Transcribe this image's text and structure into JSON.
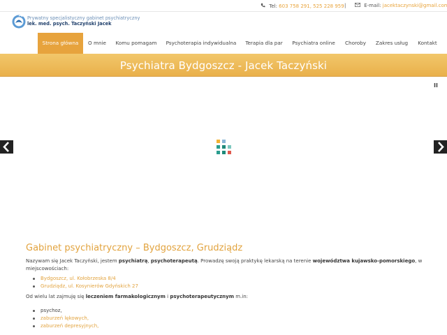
{
  "topbar": {
    "tel_label": "Tel:",
    "tel_numbers": "603 758 291, 525 228 959",
    "separator": "|",
    "email_label": "E-mail:",
    "email": "jacektaczynski@gmail.com"
  },
  "logo": {
    "line1": "Prywatny specjalistyczny gabinet psychiatryczny",
    "line2": "lek. med. psych. Taczyński Jacek"
  },
  "nav": {
    "items": [
      {
        "label": "Strona główna",
        "active": true
      },
      {
        "label": "O mnie"
      },
      {
        "label": "Komu pomagam"
      },
      {
        "label": "Psychoterapia indywidualna"
      },
      {
        "label": "Terapia dla par"
      },
      {
        "label": "Psychiatra online"
      },
      {
        "label": "Choroby"
      },
      {
        "label": "Zakres usług"
      },
      {
        "label": "Kontakt"
      }
    ]
  },
  "banner": {
    "title": "Psychiatra Bydgoszcz - Jacek Taczyński"
  },
  "slider": {
    "pause_glyph": "II"
  },
  "content": {
    "heading": "Gabinet psychiatryczny – Bydgoszcz, Grudziądz",
    "intro_1": "Nazywam się Jacek Taczyński, jestem ",
    "intro_b1": "psychiatrą",
    "intro_2": ", ",
    "intro_b2": "psychoterapeutą",
    "intro_3": ". Prowadzę swoją praktykę lekarską na terenie ",
    "intro_b3": "województwa kujawsko-pomorskiego",
    "intro_4": ", w miejscowościach:",
    "locations": [
      "Bydgoszcz, ul. Kołobrzeska 8/4",
      "Grudziądz, ul. Kosynierów Gdyńskich 27"
    ],
    "para2_1": "Od wielu lat zajmuję się ",
    "para2_b1": "leczeniem farmakologicznym",
    "para2_2": " i  ",
    "para2_b2": "psychoterapeutycznym",
    "para2_3": "  m.in:",
    "conditions": [
      {
        "label": "psychoz,",
        "link": false
      },
      {
        "label": "zaburzeń lękowych,",
        "link": true
      },
      {
        "label": "zaburzeń depresyjnych,",
        "link": true
      }
    ]
  },
  "colors": {
    "accent": "#e2a33e",
    "banner_top": "#f2c76b",
    "banner_bottom": "#e9b04b",
    "logo_blue": "#1f3f6b"
  },
  "icons": {
    "phone": "phone-icon",
    "mail": "envelope-icon",
    "logo": "logo-icon",
    "prev": "chevron-left-icon",
    "next": "chevron-right-icon",
    "loader": "loading-icon"
  }
}
